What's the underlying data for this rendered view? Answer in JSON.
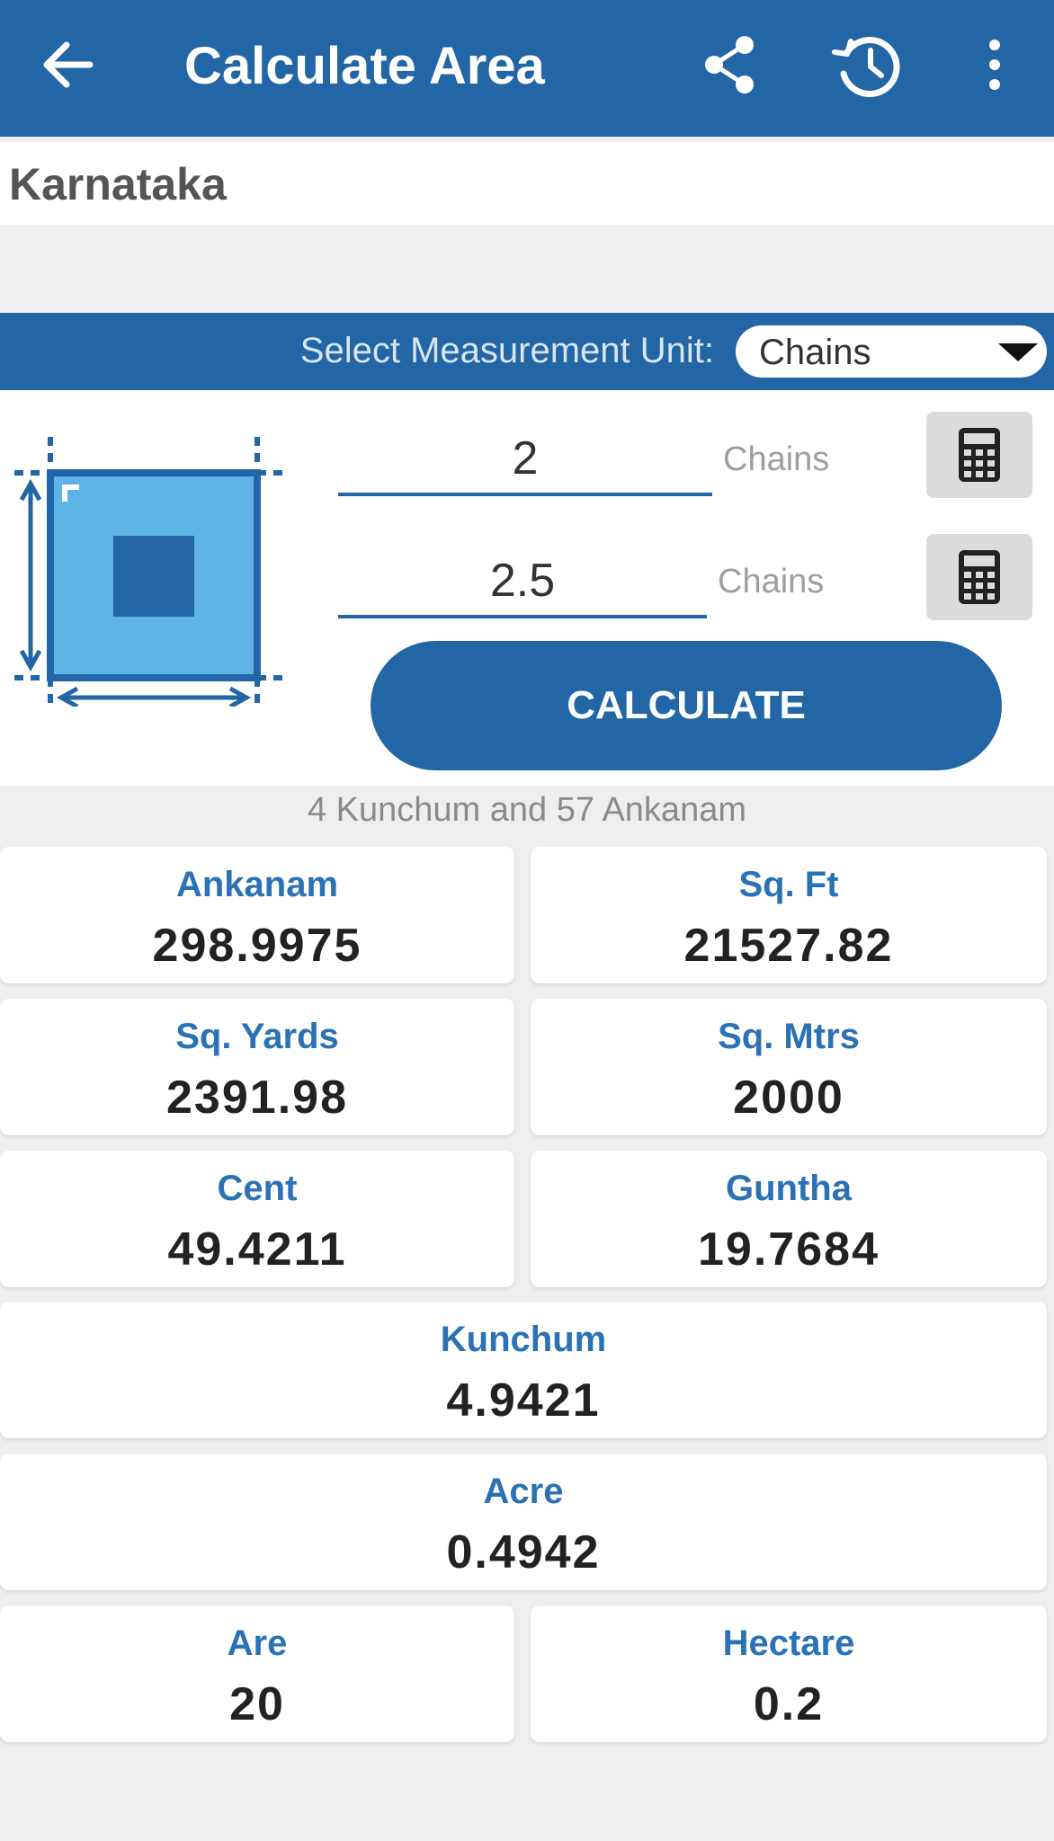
{
  "appbar": {
    "title": "Calculate Area",
    "icons": [
      "back-arrow-icon",
      "share-icon",
      "history-icon",
      "more-vert-icon"
    ],
    "color": "#2266a5"
  },
  "state": "Karnataka",
  "unit_bar": {
    "label": "Select Measurement Unit:",
    "selected": "Chains"
  },
  "inputs": [
    {
      "value": "2",
      "unit": "Chains"
    },
    {
      "value": "2.5",
      "unit": "Chains"
    }
  ],
  "calculate_label": "CALCULATE",
  "summary": "4 Kunchum  and 57 Ankanam",
  "results": {
    "ankanam": {
      "label": "Ankanam",
      "value": "298.9975"
    },
    "sqft": {
      "label": "Sq. Ft",
      "value": "21527.82"
    },
    "sqyards": {
      "label": "Sq. Yards",
      "value": "2391.98"
    },
    "sqmtrs": {
      "label": "Sq. Mtrs",
      "value": "2000"
    },
    "cent": {
      "label": "Cent",
      "value": "49.4211"
    },
    "guntha": {
      "label": "Guntha",
      "value": "19.7684"
    },
    "kunchum": {
      "label": "Kunchum",
      "value": "4.9421"
    },
    "acre": {
      "label": "Acre",
      "value": "0.4942"
    },
    "are": {
      "label": "Are",
      "value": "20"
    },
    "hectare": {
      "label": "Hectare",
      "value": "0.2"
    }
  }
}
